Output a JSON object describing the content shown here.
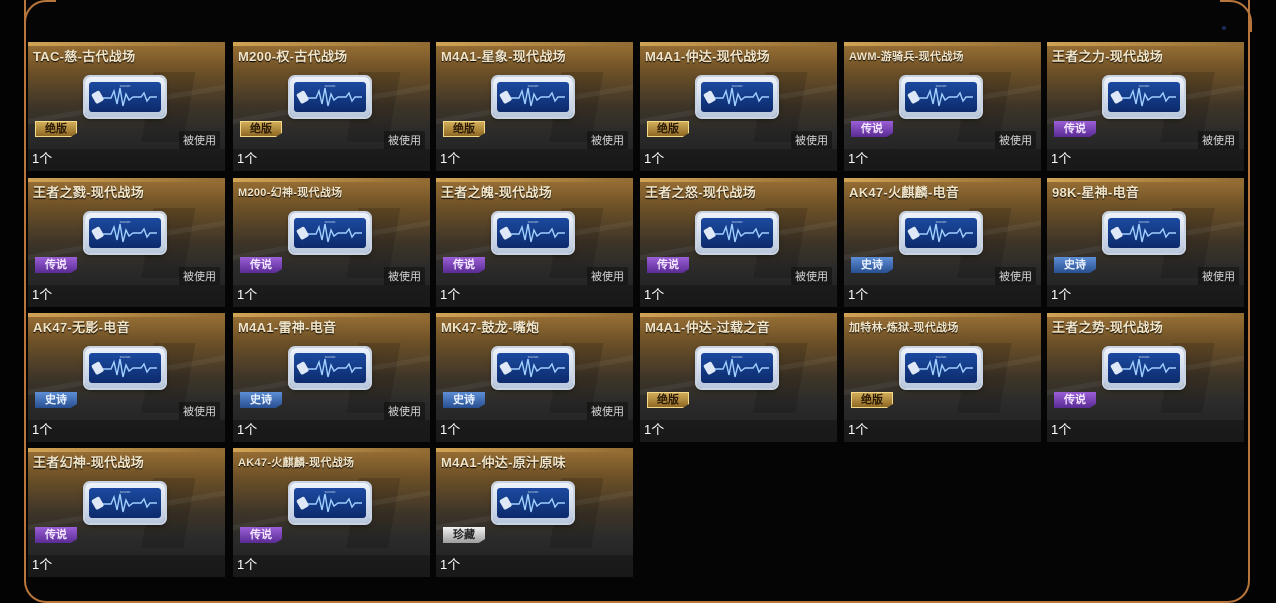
{
  "items": [
    {
      "name": "TAC-慈-古代战场",
      "rarity": "绝版",
      "rclass": "r-lengendary",
      "used": "被使用",
      "count": "1个"
    },
    {
      "name": "M200-权-古代战场",
      "rarity": "绝版",
      "rclass": "r-lengendary",
      "used": "被使用",
      "count": "1个"
    },
    {
      "name": "M4A1-星象-现代战场",
      "rarity": "绝版",
      "rclass": "r-lengendary",
      "used": "被使用",
      "count": "1个"
    },
    {
      "name": "M4A1-仲达-现代战场",
      "rarity": "绝版",
      "rclass": "r-lengendary",
      "used": "被使用",
      "count": "1个"
    },
    {
      "name": "AWM-游骑兵-现代战场",
      "rarity": "传说",
      "rclass": "r-legend",
      "used": "被使用",
      "count": "1个",
      "small": true
    },
    {
      "name": "王者之力-现代战场",
      "rarity": "传说",
      "rclass": "r-legend",
      "used": "被使用",
      "count": "1个"
    },
    {
      "name": "王者之戮-现代战场",
      "rarity": "传说",
      "rclass": "r-legend",
      "used": "被使用",
      "count": "1个"
    },
    {
      "name": "M200-幻神-现代战场",
      "rarity": "传说",
      "rclass": "r-legend",
      "used": "被使用",
      "count": "1个",
      "small": true
    },
    {
      "name": "王者之魄-现代战场",
      "rarity": "传说",
      "rclass": "r-legend",
      "used": "被使用",
      "count": "1个"
    },
    {
      "name": "王者之怒-现代战场",
      "rarity": "传说",
      "rclass": "r-legend",
      "used": "被使用",
      "count": "1个"
    },
    {
      "name": "AK47-火麒麟-电音",
      "rarity": "史诗",
      "rclass": "r-epic",
      "used": "被使用",
      "count": "1个"
    },
    {
      "name": "98K-星神-电音",
      "rarity": "史诗",
      "rclass": "r-epic",
      "used": "被使用",
      "count": "1个"
    },
    {
      "name": "AK47-无影-电音",
      "rarity": "史诗",
      "rclass": "r-epic",
      "used": "被使用",
      "count": "1个"
    },
    {
      "name": "M4A1-雷神-电音",
      "rarity": "史诗",
      "rclass": "r-epic",
      "used": "被使用",
      "count": "1个"
    },
    {
      "name": "MK47-鼓龙-嘴炮",
      "rarity": "史诗",
      "rclass": "r-epic",
      "used": "被使用",
      "count": "1个"
    },
    {
      "name": "M4A1-仲达-过载之音",
      "rarity": "绝版",
      "rclass": "r-lengendary",
      "used": "",
      "count": "1个"
    },
    {
      "name": "加特林-炼狱-现代战场",
      "rarity": "绝版",
      "rclass": "r-lengendary",
      "used": "",
      "count": "1个",
      "small": true
    },
    {
      "name": "王者之势-现代战场",
      "rarity": "传说",
      "rclass": "r-legend",
      "used": "",
      "count": "1个"
    },
    {
      "name": "王者幻神-现代战场",
      "rarity": "传说",
      "rclass": "r-legend",
      "used": "",
      "count": "1个"
    },
    {
      "name": "AK47-火麒麟-现代战场",
      "rarity": "传说",
      "rclass": "r-legend",
      "used": "",
      "count": "1个",
      "small": true
    },
    {
      "name": "M4A1-仲达-原汁原味",
      "rarity": "珍藏",
      "rclass": "r-rare",
      "used": "",
      "count": "1个"
    }
  ]
}
